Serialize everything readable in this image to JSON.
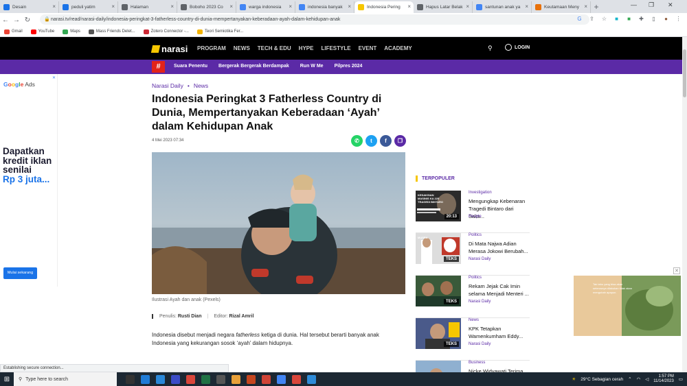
{
  "browser": {
    "tabs": [
      {
        "label": "Desain",
        "color": "#1a73e8",
        "icon": "globe-icon",
        "active": false
      },
      {
        "label": "peduli yatim",
        "color": "#1a73e8",
        "icon": "globe-icon",
        "active": false
      },
      {
        "label": "Halaman",
        "color": "#5f6368",
        "icon": "globe-icon",
        "active": false
      },
      {
        "label": "Boboho 2023 Co",
        "color": "#5f6368",
        "icon": "globe-icon",
        "active": false
      },
      {
        "label": "warga indonesia",
        "color": "#4285f4",
        "icon": "google-icon",
        "active": false
      },
      {
        "label": "indonesia banyak",
        "color": "#4285f4",
        "icon": "google-icon",
        "active": false
      },
      {
        "label": "Indonesia Pering",
        "color": "#f6c600",
        "icon": "narasi-icon",
        "active": true
      },
      {
        "label": "Hapus Latar Belak",
        "color": "#5f6368",
        "icon": "eye-icon",
        "active": false
      },
      {
        "label": "santunan anak ya",
        "color": "#4285f4",
        "icon": "google-icon",
        "active": false
      },
      {
        "label": "Keutamaan Meny",
        "color": "#e8710a",
        "icon": "globe-icon",
        "active": false
      }
    ],
    "url": "narasi.tv/read/narasi-daily/indonesia-peringkat-3-fatherless-country-di-dunia-mempertanyakan-keberadaan-ayah-dalam-kehidupan-anak",
    "bookmarks": [
      {
        "label": "Gmail",
        "color": "#ea4335"
      },
      {
        "label": "YouTube",
        "color": "#ff0000"
      },
      {
        "label": "Maps",
        "color": "#34a853"
      },
      {
        "label": "Mass Friends Delet...",
        "color": "#555555"
      },
      {
        "label": "Zotero Connector -...",
        "color": "#cc2936"
      },
      {
        "label": "Teori Semiotika Fer...",
        "color": "#f4b400"
      }
    ],
    "status_text": "Establishing secure connection..."
  },
  "site": {
    "logo": "narasi",
    "nav": [
      "PROGRAM",
      "NEWS",
      "TECH & EDU",
      "HYPE",
      "LIFESTYLE",
      "EVENT",
      "ACADEMY"
    ],
    "login": "LOGIN",
    "hashtag": "#",
    "subnav": [
      "Suara Penentu",
      "Bergerak Bergerak Berdampak",
      "Run W Me",
      "Pilpres 2024"
    ]
  },
  "ad_left": {
    "brand_parts": [
      "G",
      "o",
      "o",
      "g",
      "l",
      "e"
    ],
    "brand_suffix": " Ads",
    "headline": "Dapatkan kredit iklan senilai",
    "highlight": "Rp 3 juta...",
    "button": "Mulai sekarang"
  },
  "article": {
    "category": "Narasi Daily",
    "subcategory": "News",
    "title": "Indonesia Peringkat 3 Fatherless Country di Dunia, Mempertanyakan Keberadaan ‘Ayah’ dalam Kehidupan Anak",
    "date": "4 Mei 2023 07:34",
    "caption": "Ilustrasi Ayah dan anak (Pexels)",
    "author_label": "Penulis:",
    "author": "Rusti Dian",
    "editor_label": "Editor:",
    "editor": "Rizal Amril",
    "body_before": "Indonesia disebut menjadi negara ",
    "body_italic": "fatherless",
    "body_after": " ketiga di dunia. Hal tersebut berarti banyak anak Indonesia yang kekurangan sosok ‘ayah’ dalam hidupnya."
  },
  "sidebar": {
    "heading": "TERPOPULER",
    "items": [
      {
        "category": "Investigation",
        "title": "Mengungkap Kebenaran Tragedi Bintaro dari Saks...",
        "source": "People",
        "badge": "20:13",
        "thumb_text": "KESAKSIAN MASINIS KA 225 TRAGEDI BINTARO"
      },
      {
        "category": "Politics",
        "title": "Di Mata Najwa Adian Merasa Jokowi Berubah...",
        "source": "Narasi Daily",
        "badge": "TEKS",
        "thumb_text": "MUSRA"
      },
      {
        "category": "Politics",
        "title": "Rekam Jejak Cak Imin selama Menjadi Menteri ...",
        "source": "Narasi Daily",
        "badge": "TEKS",
        "thumb_text": ""
      },
      {
        "category": "News",
        "title": "KPK Tetapkan Wamenkumham Eddy...",
        "source": "Narasi Daily",
        "badge": "TEKS",
        "thumb_text": ""
      },
      {
        "category": "Business",
        "title": "Nicke Widyawati Terima...",
        "source": "",
        "badge": "",
        "thumb_text": ""
      }
    ]
  },
  "ad_right": {
    "text": "Tak tahu yang bisa akan seterusnya dilakukan tidak akan mengubah apapun."
  },
  "taskbar": {
    "search_placeholder": "Type here to search",
    "weather": "29°C  Sebagian cerah",
    "time": "1:57 PM",
    "date": "11/14/2023"
  }
}
